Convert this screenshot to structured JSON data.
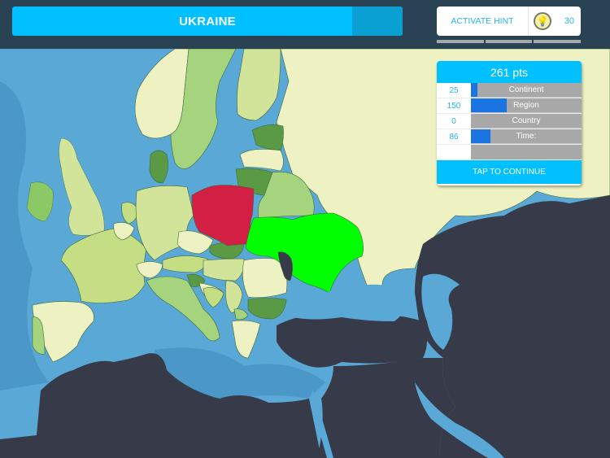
{
  "game": {
    "target_country": "UKRAINE",
    "timer_remaining_fraction": 0.13
  },
  "hint": {
    "label": "ACTIVATE HINT",
    "icon": "lightbulb-icon",
    "count": "30",
    "slots": 3
  },
  "score": {
    "total": "261 pts",
    "rows": [
      {
        "value": "25",
        "label": "Continent",
        "fill_fraction": 0.06
      },
      {
        "value": "150",
        "label": "Region",
        "fill_fraction": 0.32
      },
      {
        "value": "0",
        "label": "Country",
        "fill_fraction": 0.0
      },
      {
        "value": "86",
        "label": "Time:",
        "fill_fraction": 0.18
      }
    ],
    "continue_label": "TAP TO CONTINUE"
  },
  "map": {
    "colors": {
      "sea": "#5aa8d6",
      "deep_sea": "#4b97c8",
      "non_playable_land": "#373a48",
      "russia_land": "#eef2c2",
      "selected_correct": "#00ff00",
      "selected_wrong": "#d21f43"
    },
    "countries": [
      {
        "name": "Ukraine",
        "state": "correct"
      },
      {
        "name": "Poland",
        "state": "wrong"
      },
      {
        "name": "Moldova",
        "state": "unavailable"
      }
    ]
  }
}
